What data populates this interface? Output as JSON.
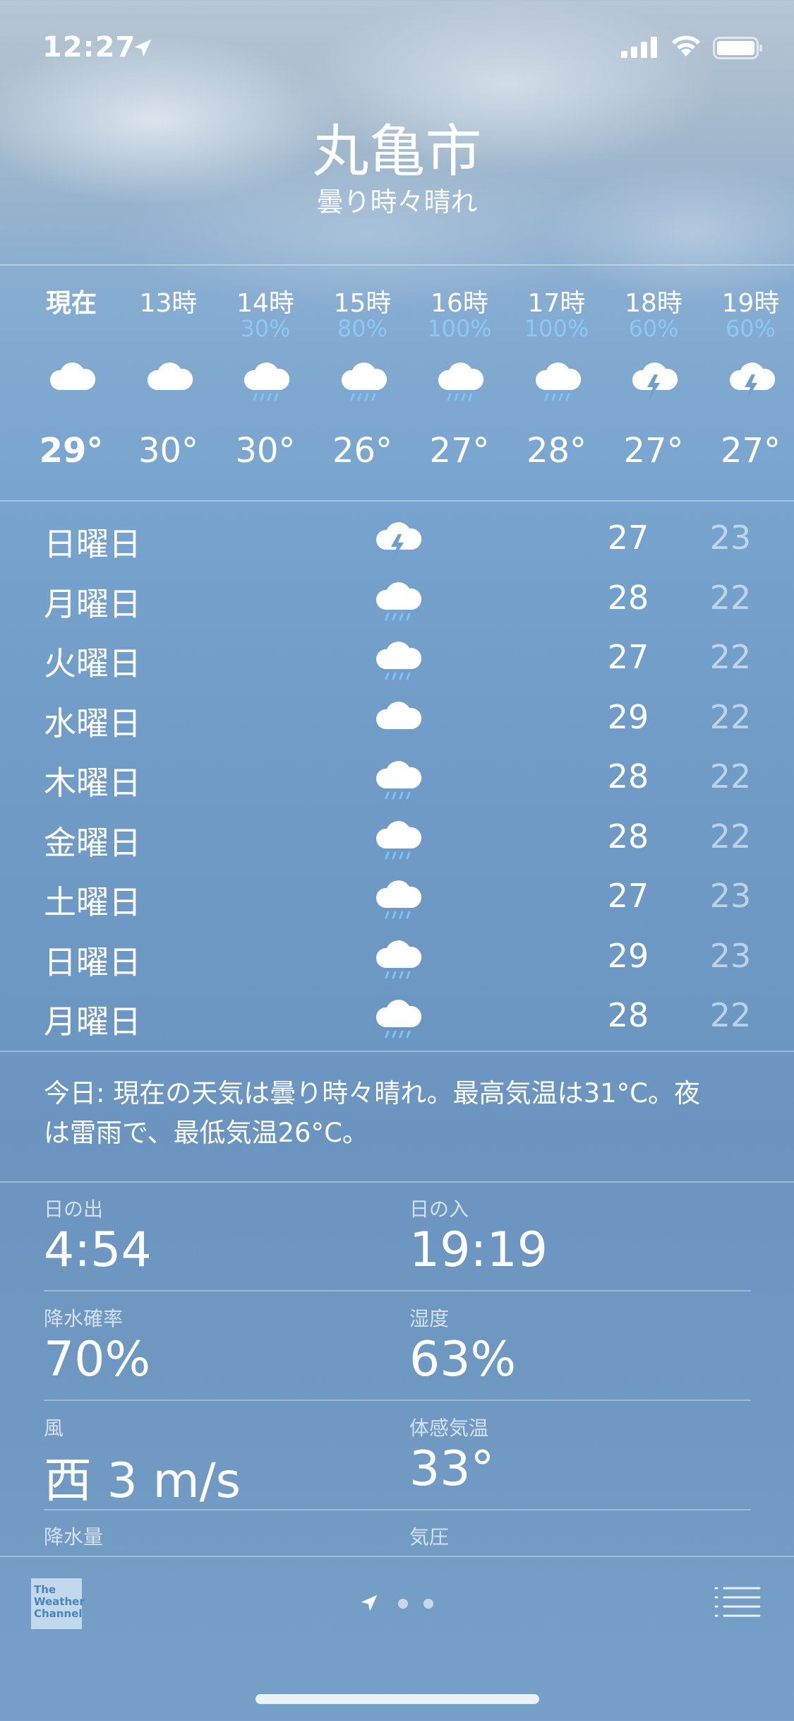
{
  "status_bar": {
    "time": "12:27"
  },
  "location": {
    "city": "丸亀市",
    "condition": "曇り時々晴れ"
  },
  "hourly": [
    {
      "label": "現在",
      "pct": "",
      "icon": "cloud",
      "temp": "29°"
    },
    {
      "label": "13時",
      "pct": "",
      "icon": "cloud",
      "temp": "30°"
    },
    {
      "label": "14時",
      "pct": "30%",
      "icon": "cloud-rain",
      "temp": "30°"
    },
    {
      "label": "15時",
      "pct": "80%",
      "icon": "cloud-rain",
      "temp": "26°"
    },
    {
      "label": "16時",
      "pct": "100%",
      "icon": "cloud-rain",
      "temp": "27°"
    },
    {
      "label": "17時",
      "pct": "100%",
      "icon": "cloud-rain",
      "temp": "28°"
    },
    {
      "label": "18時",
      "pct": "60%",
      "icon": "cloud-bolt",
      "temp": "27°"
    },
    {
      "label": "19時",
      "pct": "60%",
      "icon": "cloud-bolt",
      "temp": "27°"
    }
  ],
  "daily": [
    {
      "day": "日曜日",
      "icon": "cloud-bolt",
      "hi": "27",
      "lo": "23"
    },
    {
      "day": "月曜日",
      "icon": "cloud-rain",
      "hi": "28",
      "lo": "22"
    },
    {
      "day": "火曜日",
      "icon": "cloud-rain",
      "hi": "27",
      "lo": "22"
    },
    {
      "day": "水曜日",
      "icon": "cloud",
      "hi": "29",
      "lo": "22"
    },
    {
      "day": "木曜日",
      "icon": "cloud-rain",
      "hi": "28",
      "lo": "22"
    },
    {
      "day": "金曜日",
      "icon": "cloud-rain",
      "hi": "28",
      "lo": "22"
    },
    {
      "day": "土曜日",
      "icon": "cloud-rain",
      "hi": "27",
      "lo": "23"
    },
    {
      "day": "日曜日",
      "icon": "cloud-rain",
      "hi": "29",
      "lo": "23"
    },
    {
      "day": "月曜日",
      "icon": "cloud-rain",
      "hi": "28",
      "lo": "22"
    }
  ],
  "summary": {
    "line1": "今日: 現在の天気は曇り時々晴れ。最高気温は31°C。夜",
    "line2": "は雷雨で、最低気温26°C。"
  },
  "details": {
    "sunrise": {
      "label": "日の出",
      "value": "4:54"
    },
    "sunset": {
      "label": "日の入",
      "value": "19:19"
    },
    "precip_chance": {
      "label": "降水確率",
      "value": "70%"
    },
    "humidity": {
      "label": "湿度",
      "value": "63%"
    },
    "wind": {
      "label": "風",
      "value": "西 3 m/s"
    },
    "feels_like": {
      "label": "体感気温",
      "value": "33°"
    },
    "precip_amount": {
      "label": "降水量"
    },
    "pressure": {
      "label": "気圧"
    }
  },
  "footer": {
    "logo_text": [
      "The",
      "Weather",
      "Channel"
    ]
  },
  "colors": {
    "precip_pct": "#8cc8f5",
    "rain_drops": "#7cc4f7"
  }
}
